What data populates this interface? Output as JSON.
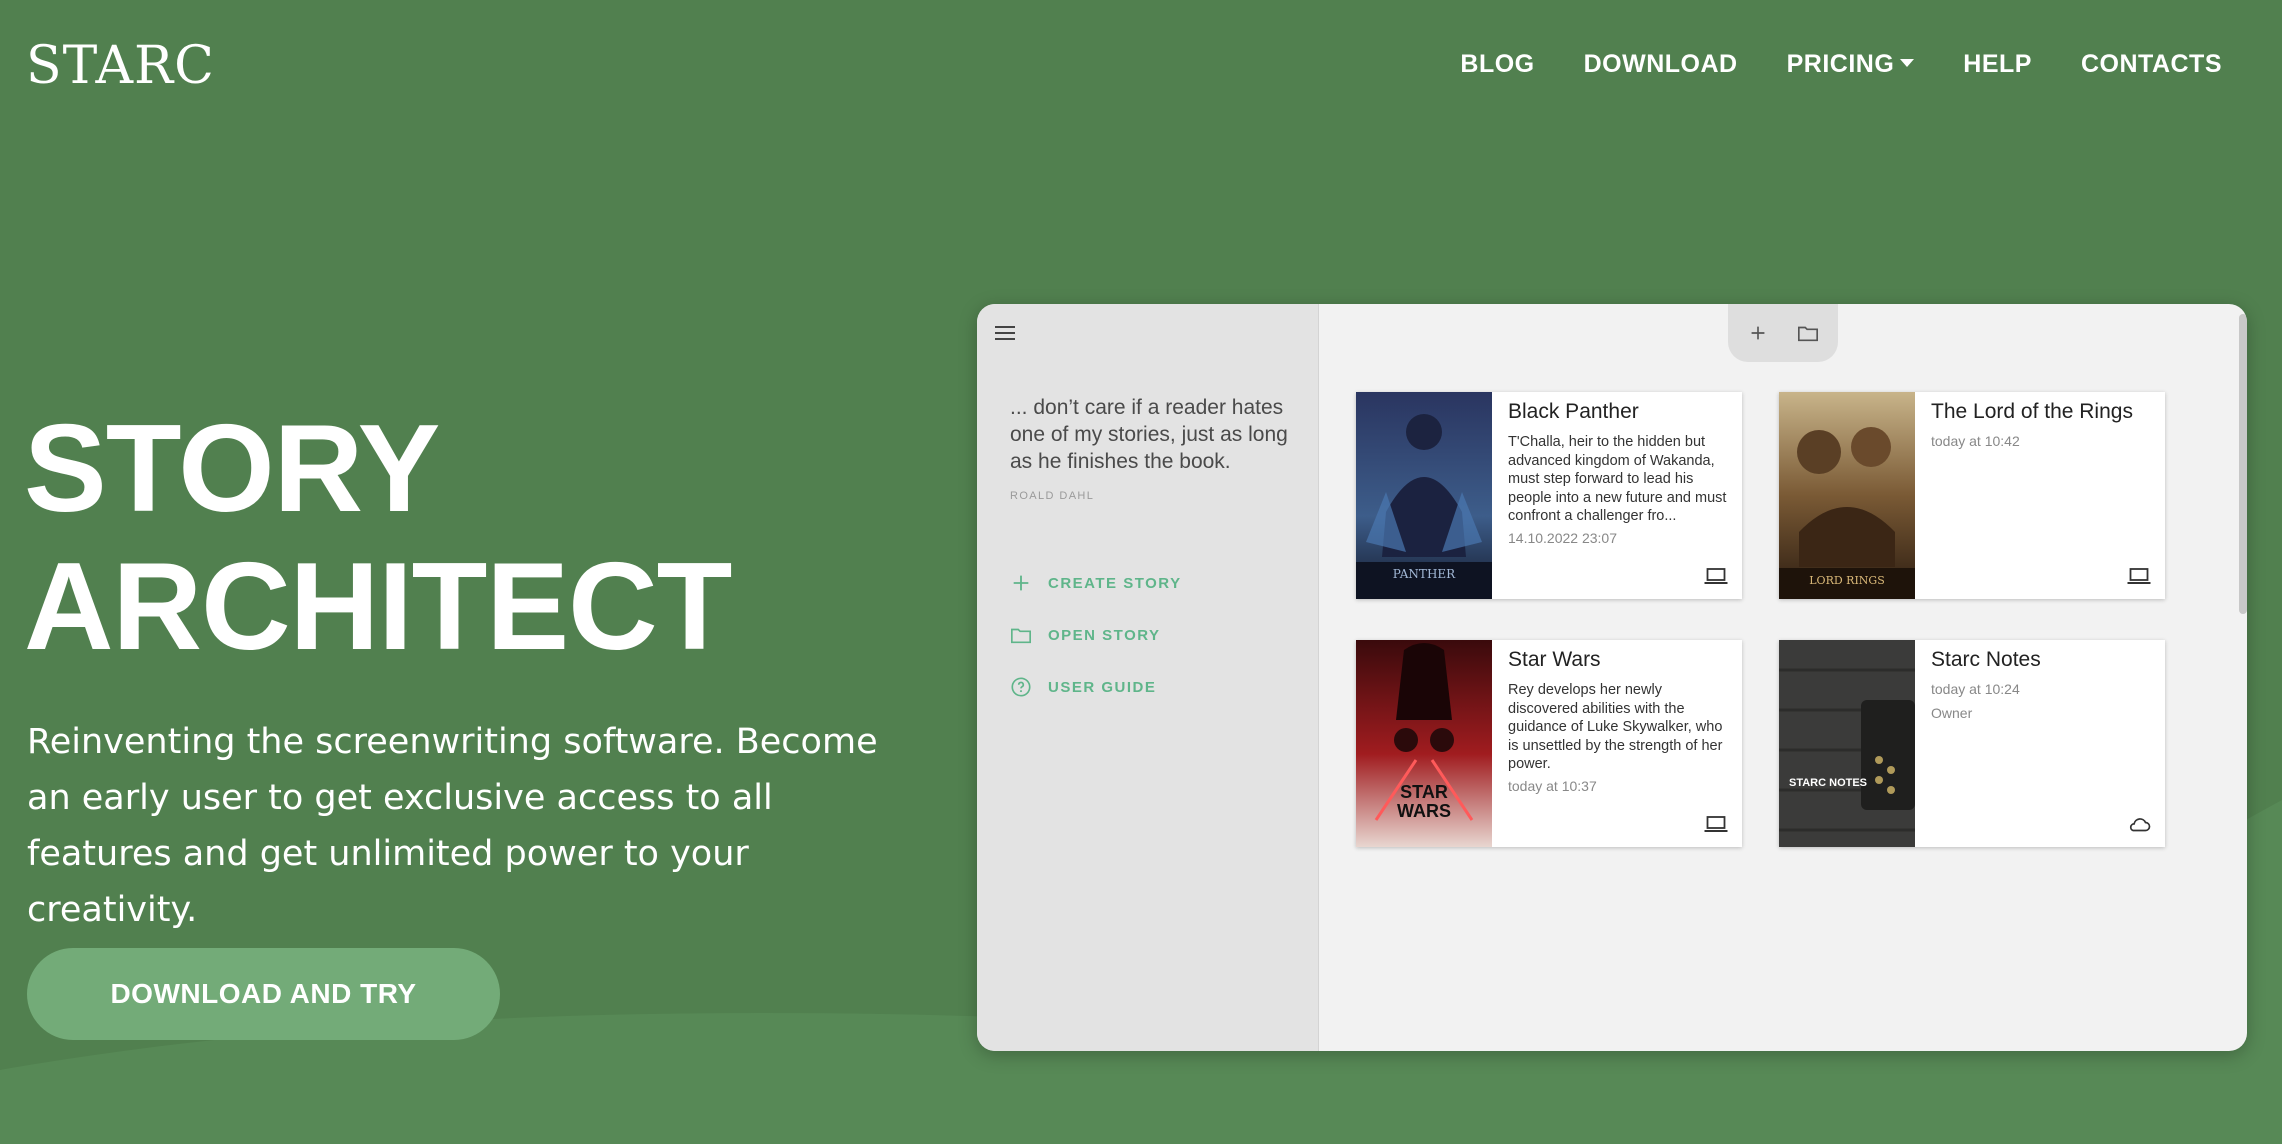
{
  "brand": {
    "logo": "STARC"
  },
  "nav": {
    "items": [
      {
        "label": "BLOG"
      },
      {
        "label": "DOWNLOAD"
      },
      {
        "label": "PRICING"
      },
      {
        "label": "HELP"
      },
      {
        "label": "CONTACTS"
      }
    ]
  },
  "hero": {
    "title_line1": "STORY",
    "title_line2": "ARCHITECT",
    "subtitle": "Reinventing the screenwriting software. Become an early user to get exclusive access to all features and get unlimited power to your creativity.",
    "cta_label": "DOWNLOAD AND TRY"
  },
  "app": {
    "quote": "... don’t care if a reader hates one of my stories, just as long as he finishes the book.",
    "quote_author": "ROALD DAHL",
    "actions": [
      {
        "label": "CREATE STORY",
        "icon": "plus-icon"
      },
      {
        "label": "OPEN STORY",
        "icon": "folder-icon"
      },
      {
        "label": "USER GUIDE",
        "icon": "help-circle-icon"
      }
    ],
    "toolbar": [
      {
        "icon": "plus-icon"
      },
      {
        "icon": "folder-icon"
      }
    ],
    "projects": [
      {
        "title": "Black Panther",
        "description": "T'Challa, heir to the hidden but advanced kingdom of Wakanda, must step forward to lead his people into a new future and must confront a challenger fro...",
        "date": "14.10.2022 23:07",
        "owner": "",
        "storage": "laptop-icon"
      },
      {
        "title": "The Lord of the Rings",
        "description": "",
        "date": "today at 10:42",
        "owner": "",
        "storage": "laptop-icon"
      },
      {
        "title": "Star Wars",
        "description": "Rey develops her newly discovered abilities with the guidance of Luke Skywalker, who is unsettled by the strength of her power.",
        "date": "today at 10:37",
        "owner": "",
        "storage": "laptop-icon"
      },
      {
        "title": "Starc Notes",
        "description": "",
        "date": "today at 10:24",
        "owner": "Owner",
        "storage": "cloud-icon"
      }
    ],
    "posters": {
      "black_panther": "PANTHER",
      "lord_of_rings": "LORD RINGS",
      "star_wars_line1": "STAR",
      "star_wars_line2": "WARS",
      "starc_notes": "STARC NOTES"
    }
  },
  "colors": {
    "background": "#51804f",
    "cta": "#73ab78",
    "accent": "#5fb58a"
  }
}
